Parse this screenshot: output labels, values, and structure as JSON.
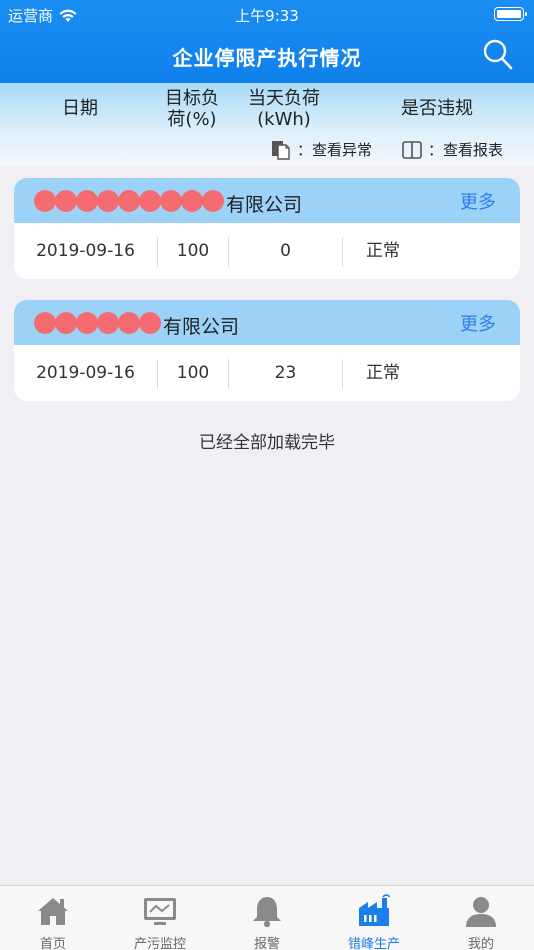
{
  "status_bar": {
    "carrier": "运营商",
    "time": "上午9:33"
  },
  "header": {
    "title": "企业停限产执行情况"
  },
  "columns": {
    "date": "日期",
    "target_line1": "目标负",
    "target_line2": "荷(%)",
    "load_line1": "当天负荷",
    "load_line2": "(kWh)",
    "violation": "是否违规"
  },
  "legend": {
    "abnormal": "：查看异常",
    "report": "：查看报表"
  },
  "cards": [
    {
      "company_suffix": "有限公司",
      "more": "更多",
      "date": "2019-09-16",
      "target": "100",
      "load": "0",
      "status": "正常"
    },
    {
      "company_suffix": "有限公司",
      "more": "更多",
      "date": "2019-09-16",
      "target": "100",
      "load": "23",
      "status": "正常"
    }
  ],
  "footer_text": "已经全部加载完毕",
  "tabs": [
    {
      "label": "首页",
      "icon": "home-icon"
    },
    {
      "label": "产污监控",
      "icon": "monitor-icon"
    },
    {
      "label": "报警",
      "icon": "bell-icon"
    },
    {
      "label": "错峰生产",
      "icon": "factory-icon",
      "active": true
    },
    {
      "label": "我的",
      "icon": "user-icon"
    }
  ],
  "colors": {
    "header_blue": "#1a8ef2",
    "card_head": "#9cd2f8",
    "accent": "#1a7fe8",
    "redaction": "#f56b72"
  }
}
